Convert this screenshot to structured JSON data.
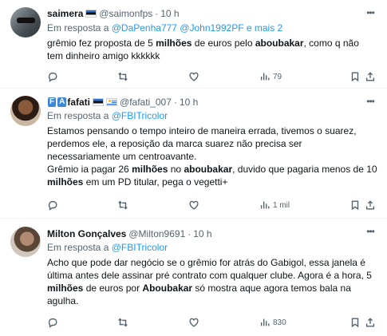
{
  "tweets": [
    {
      "display_name": "saimera",
      "handle": "@saimonfps",
      "time": "10 h",
      "reply_prefix": "Em resposta a",
      "reply_mentions": "@DaPenha777 @John1992PF e mais 2",
      "body": [
        [
          {
            "t": "grêmio fez proposta de 5 "
          },
          {
            "t": "milhões",
            "b": true
          },
          {
            "t": " de euros pelo "
          },
          {
            "t": "aboubakar",
            "b": true
          },
          {
            "t": ", como q não tem dinheiro amigo kkkkkk"
          }
        ]
      ],
      "views": "79"
    },
    {
      "display_name": "fafati",
      "handle": "@fafati_007",
      "time": "10 h",
      "reply_prefix": "Em resposta a",
      "reply_mentions": "@FBITricolor",
      "body": [
        [
          {
            "t": "Estamos pensando o tempo inteiro de maneira errada, tivemos o suarez, perdemos ele, a reposição da marca suarez não precisa ser necessariamente um centroavante."
          }
        ],
        [
          {
            "t": "Grêmio ia pagar 26 "
          },
          {
            "t": "milhões",
            "b": true
          },
          {
            "t": " no "
          },
          {
            "t": "aboubakar",
            "b": true
          },
          {
            "t": ", duvido que pagaria menos de 10 "
          },
          {
            "t": "milhões",
            "b": true
          },
          {
            "t": " em um PD titular, pega o vegetti+"
          }
        ]
      ],
      "views": "1 mil"
    },
    {
      "display_name": "Milton Gonçalves",
      "handle": "@Milton9691",
      "time": "10 h",
      "reply_prefix": "Em resposta a",
      "reply_mentions": "@FBITricolor",
      "body": [
        [
          {
            "t": "Acho que pode dar negócio se o grêmio for atrás do Gabigol, essa janela é última antes dele assinar pré contrato com qualquer clube. Agora é a hora, 5 "
          },
          {
            "t": "milhões",
            "b": true
          },
          {
            "t": " de euros por "
          },
          {
            "t": "Aboubakar",
            "b": true
          },
          {
            "t": " só mostra aque agora temos bala na agulha."
          }
        ]
      ],
      "views": "830"
    }
  ],
  "icons": {
    "more": "more-dots-icon",
    "reply": "reply-icon",
    "retweet": "retweet-icon",
    "like": "heart-icon",
    "views": "views-chart-icon",
    "bookmark": "bookmark-icon",
    "share": "share-icon"
  },
  "colors": {
    "link": "#1d9bf0",
    "secondary_text": "#536471",
    "primary_text": "#0f1419",
    "divider": "#eff3f4"
  }
}
